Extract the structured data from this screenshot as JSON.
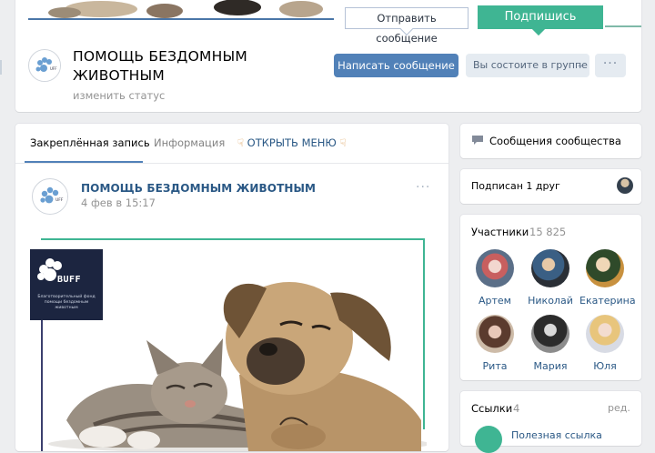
{
  "header": {
    "tooltip_send": "Отправить сообщение",
    "subscribe_banner": "Подпишись",
    "group_name": "ПОМОЩЬ БЕЗДОМНЫМ ЖИВОТНЫМ",
    "change_status": "изменить статус",
    "write_message": "Написать сообщение",
    "membership": "Вы состоите в группе",
    "more": "···"
  },
  "tabs": {
    "pinned": "Закреплённая запись",
    "info": "Информация",
    "open_menu": "ОТКРЫТЬ МЕНЮ"
  },
  "post": {
    "author": "ПОМОЩЬ БЕЗДОМНЫМ ЖИВОТНЫМ",
    "date": "4 фев в 15:17",
    "more": "···",
    "logo_title": "BUFF",
    "logo_caption": "Благотворительный фонд помощи бездомным животным"
  },
  "sidebar": {
    "community_messages": "Сообщения сообщества",
    "friends": "Подписан 1 друг",
    "members_title": "Участники",
    "members_count": "15 825",
    "members": [
      {
        "name": "Артем"
      },
      {
        "name": "Николай"
      },
      {
        "name": "Екатерина"
      },
      {
        "name": "Рита"
      },
      {
        "name": "Мария"
      },
      {
        "name": "Юля"
      }
    ],
    "links_title": "Ссылки",
    "links_count": "4",
    "links_edit": "ред.",
    "links_first": "Полезная ссылка"
  },
  "colors": {
    "accent": "#5181b8",
    "link": "#2a5885",
    "brand_green": "#3fb593",
    "background": "#edeef0"
  },
  "icons": [
    "chat-bubble-icon",
    "chevron-down-icon",
    "more-dots-icon",
    "hand-pointer-icon",
    "paw-logo-icon"
  ]
}
